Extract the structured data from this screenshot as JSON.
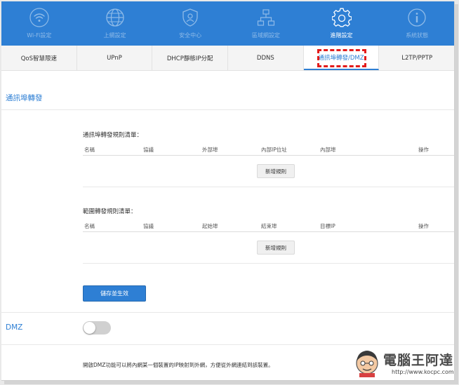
{
  "colors": {
    "accent": "#2e7fd4",
    "nav_label_inactive": "#8fbbe8",
    "highlight": "#e21b1b"
  },
  "topnav": {
    "items": [
      {
        "label": "Wi-Fi設定",
        "icon": "wifi-icon"
      },
      {
        "label": "上網設定",
        "icon": "globe-icon"
      },
      {
        "label": "安全中心",
        "icon": "shield-user-icon"
      },
      {
        "label": "區域網設定",
        "icon": "network-icon"
      },
      {
        "label": "進階設定",
        "icon": "gear-icon",
        "active": true
      },
      {
        "label": "系統狀態",
        "icon": "info-icon"
      }
    ]
  },
  "subtabs": [
    {
      "label": "QoS智慧限速"
    },
    {
      "label": "UPnP"
    },
    {
      "label": "DHCP靜態IP分配"
    },
    {
      "label": "DDNS"
    },
    {
      "label": "通訊埠轉發/DMZ",
      "active": true
    },
    {
      "label": "L2TP/PPTP"
    }
  ],
  "port_forward": {
    "section_title": "通訊埠轉發",
    "list_title": "通訊埠轉發規則清單：",
    "columns": [
      "名稱",
      "協議",
      "外部埠",
      "內部IP位址",
      "內部埠",
      "操作"
    ],
    "add_label": "新增規則"
  },
  "range_forward": {
    "list_title": "範圍轉發規則清單：",
    "columns": [
      "名稱",
      "協議",
      "起始埠",
      "結束埠",
      "目標IP",
      "操作"
    ],
    "add_label": "新增規則"
  },
  "save_label": "儲存並生效",
  "dmz": {
    "label": "DMZ",
    "enabled": false,
    "description": "開啟DMZ功能可以將內網某一個裝置的IP映射到外網，方便從外網連結到該裝置。"
  },
  "watermark": {
    "title": "電腦王阿達",
    "url": "http://www.kocpc.com.tw"
  }
}
